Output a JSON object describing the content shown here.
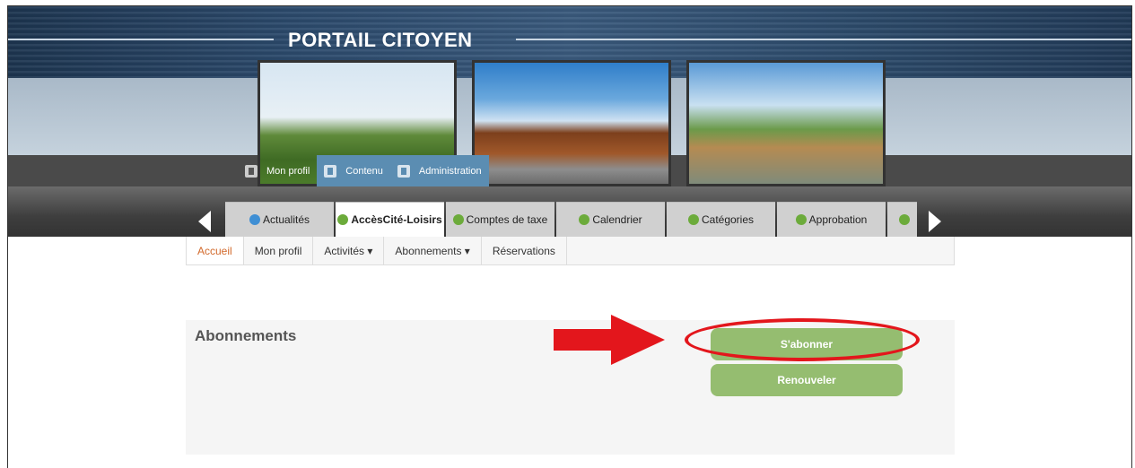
{
  "header": {
    "site_title": "PORTAIL CITOYEN"
  },
  "user_menu": [
    {
      "label": "Mon profil",
      "icon": "user-icon"
    },
    {
      "label": "Contenu",
      "icon": "document-icon"
    },
    {
      "label": "Administration",
      "icon": "admin-icon"
    }
  ],
  "tabs": [
    {
      "label": "Actualités",
      "icon": "home-icon"
    },
    {
      "label": "AccèsCité-Loisirs",
      "icon": "app-icon",
      "active": true
    },
    {
      "label": "Comptes de taxe",
      "icon": "app-icon"
    },
    {
      "label": "Calendrier",
      "icon": "app-icon"
    },
    {
      "label": "Catégories",
      "icon": "app-icon"
    },
    {
      "label": "Approbation",
      "icon": "app-icon"
    }
  ],
  "nav": {
    "items": [
      "Accueil",
      "Mon profil",
      "Activités ▾",
      "Abonnements ▾",
      "Réservations"
    ],
    "active": "Accueil"
  },
  "panel": {
    "title": "Abonnements",
    "subscribe_label": "S'abonner",
    "renew_label": "Renouveler"
  },
  "colors": {
    "accent_green": "#95bd70",
    "active_nav": "#d2692b",
    "annotation_red": "#e3161c",
    "menu_blue": "#5b8db2"
  }
}
